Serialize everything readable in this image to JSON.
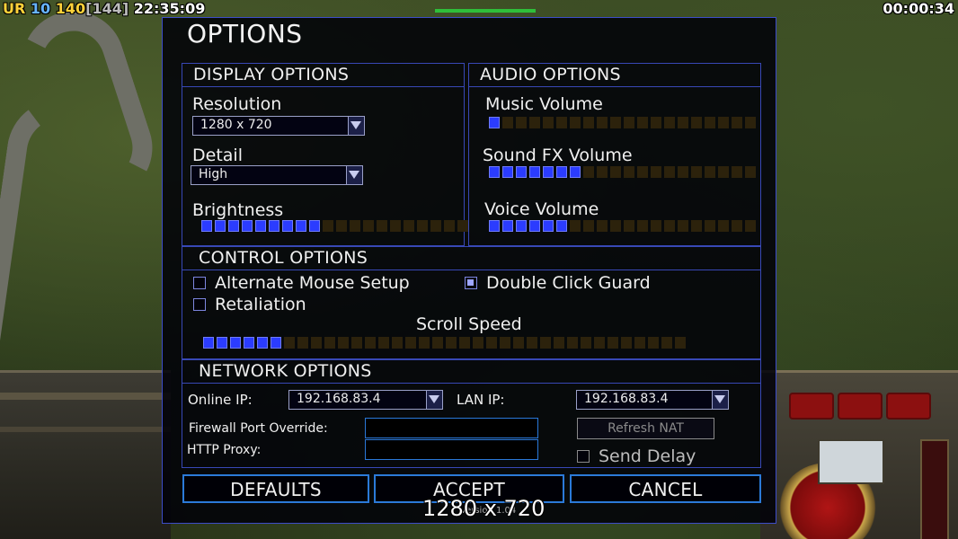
{
  "hud": {
    "faction": "UR",
    "level": "10",
    "money": "140",
    "bracket_value": "[144]",
    "clock": "22:35:09",
    "game_timer": "00:00:34"
  },
  "dialog": {
    "title": "OPTIONS",
    "display": {
      "title": "DISPLAY OPTIONS",
      "resolution_label": "Resolution",
      "resolution_value": "1280 x 720",
      "detail_label": "Detail",
      "detail_value": "High",
      "brightness_label": "Brightness",
      "brightness_level": 9,
      "brightness_segments": 20
    },
    "audio": {
      "title": "AUDIO OPTIONS",
      "music_label": "Music Volume",
      "music_level": 1,
      "sfx_label": "Sound FX Volume",
      "sfx_level": 7,
      "voice_label": "Voice Volume",
      "voice_level": 6,
      "segments": 20
    },
    "control": {
      "title": "CONTROL OPTIONS",
      "alt_mouse_label": "Alternate Mouse Setup",
      "alt_mouse_checked": false,
      "retaliation_label": "Retaliation",
      "retaliation_checked": false,
      "double_click_label": "Double Click Guard",
      "double_click_checked": true,
      "scroll_label": "Scroll Speed",
      "scroll_level": 6,
      "scroll_segments": 36
    },
    "network": {
      "title": "NETWORK OPTIONS",
      "online_ip_label": "Online IP:",
      "online_ip_value": "192.168.83.4",
      "lan_ip_label": "LAN IP:",
      "lan_ip_value": "192.168.83.4",
      "firewall_label": "Firewall Port Override:",
      "firewall_value": "",
      "http_proxy_label": "HTTP Proxy:",
      "http_proxy_value": "",
      "refresh_nat_label": "Refresh NAT",
      "send_delay_label": "Send Delay",
      "send_delay_checked": false
    },
    "buttons": {
      "defaults": "DEFAULTS",
      "accept": "ACCEPT",
      "cancel": "CANCEL"
    },
    "overlay_resolution": "1280 x 720",
    "version_text": "Version 1.04"
  },
  "colors": {
    "panel_border": "#3848b6",
    "slider_on": "#2b3cff",
    "slider_off": "#2c220c",
    "button_border": "#2b7ad8"
  }
}
